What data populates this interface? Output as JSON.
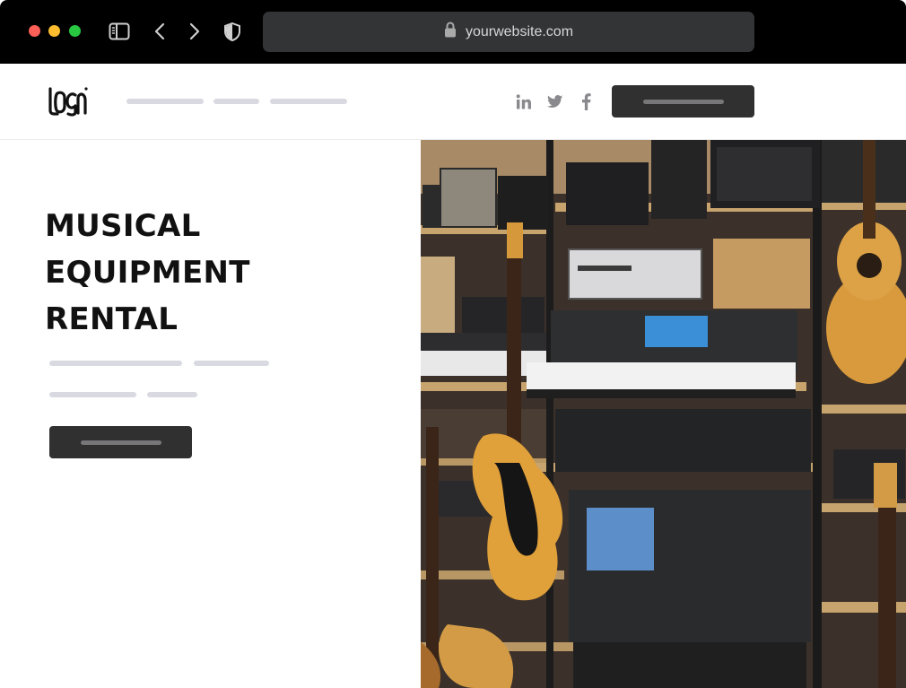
{
  "browser": {
    "url": "yourwebsite.com",
    "icons": [
      "sidebar-icon",
      "back-icon",
      "forward-icon",
      "shield-icon",
      "lock-icon"
    ]
  },
  "header": {
    "logo_text": "LOGO",
    "social": [
      "linkedin-icon",
      "twitter-icon",
      "facebook-icon"
    ]
  },
  "hero": {
    "title_lines": [
      "MUSICAL",
      "EQUIPMENT",
      "RENTAL"
    ],
    "image": "musical-equipment-photo"
  },
  "colors": {
    "chrome": "#000000",
    "address_bar": "#333436",
    "button": "#303030",
    "placeholder_line": "#d9d9e1",
    "text": "#111111"
  }
}
